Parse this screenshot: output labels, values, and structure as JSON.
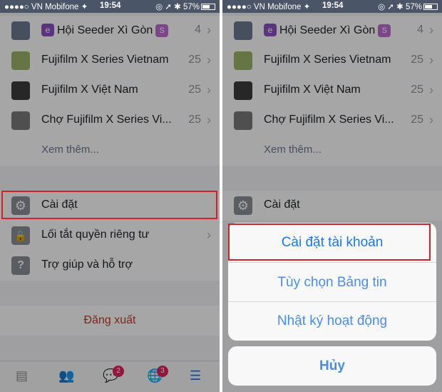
{
  "status_bar": {
    "carrier": "●●●●○ VN Mobifone ✦",
    "time": "19:54",
    "right_text": "◎ ➚ ✱ 57%"
  },
  "groups": [
    {
      "name_prefix": "Hội Seeder Xì Gòn",
      "count": "4",
      "icon": "group-photo-icon"
    },
    {
      "name": "Fujifilm X Series Vietnam",
      "count": "25",
      "icon": "group-photo-icon"
    },
    {
      "name": "Fujifilm X Việt Nam",
      "count": "25",
      "icon": "group-photo-icon"
    },
    {
      "name": "Chợ Fujifilm X Series Vi...",
      "count": "25",
      "icon": "group-photo-icon"
    }
  ],
  "badges": {
    "e": "e",
    "s": "S"
  },
  "see_more": "Xem thêm...",
  "menu": {
    "settings": "Cài đặt",
    "privacy": "Lối tắt quyền riêng tư",
    "help": "Trợ giúp và hỗ trợ",
    "logout": "Đăng xuất"
  },
  "tabbar": {
    "messages_badge": "2",
    "notifications_badge": "3"
  },
  "action_sheet": {
    "account_settings": "Cài đặt tài khoản",
    "news_feed_prefs": "Tùy chọn Bảng tin",
    "activity_log": "Nhật ký hoạt động",
    "cancel": "Hủy"
  },
  "colors": {
    "accent": "#1877f2",
    "highlight": "#d0202a",
    "logout": "#c0392b"
  }
}
